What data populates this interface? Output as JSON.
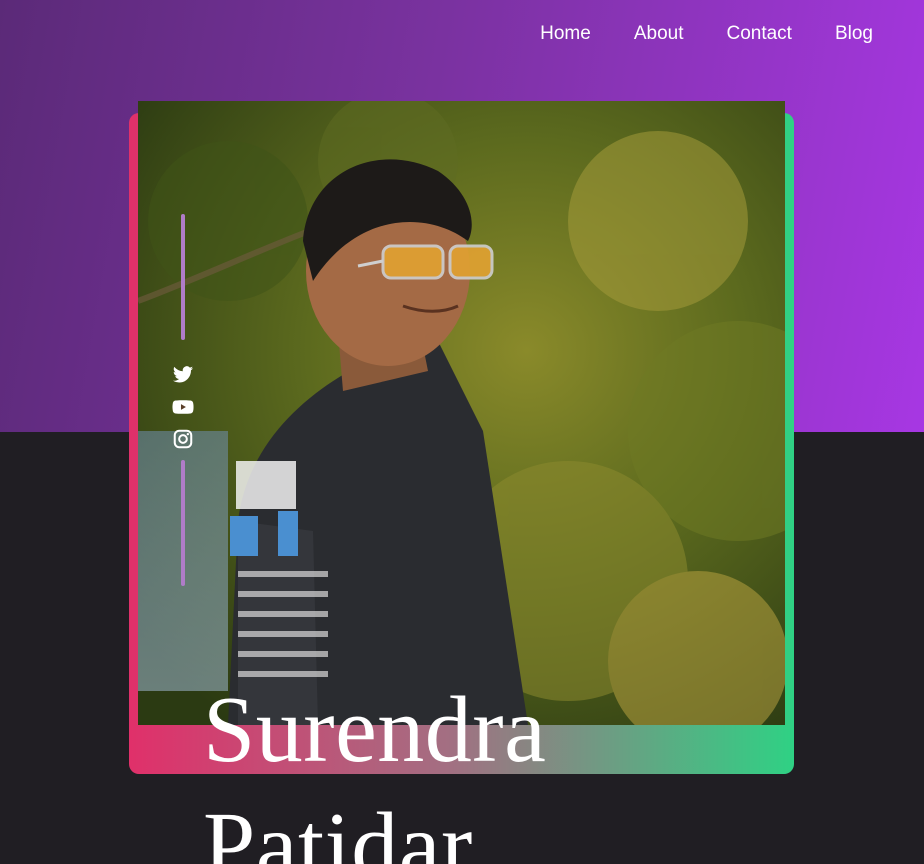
{
  "nav": {
    "items": [
      {
        "label": "Home"
      },
      {
        "label": "About"
      },
      {
        "label": "Contact"
      },
      {
        "label": "Blog"
      }
    ]
  },
  "hero": {
    "first_name": "Surendra",
    "last_name": "Patidar",
    "photo_icon": "portrait-photo"
  },
  "social": {
    "icons": [
      "twitter-icon",
      "youtube-icon",
      "instagram-icon"
    ]
  },
  "colors": {
    "hero_gradient_start": "#5b2a78",
    "hero_gradient_end": "#a737e3",
    "dark_background": "#201e23",
    "frame_gradient_start": "#e0306a",
    "frame_gradient_end": "#2fd184",
    "rail_line": "#b07cc8",
    "text": "#ffffff"
  }
}
